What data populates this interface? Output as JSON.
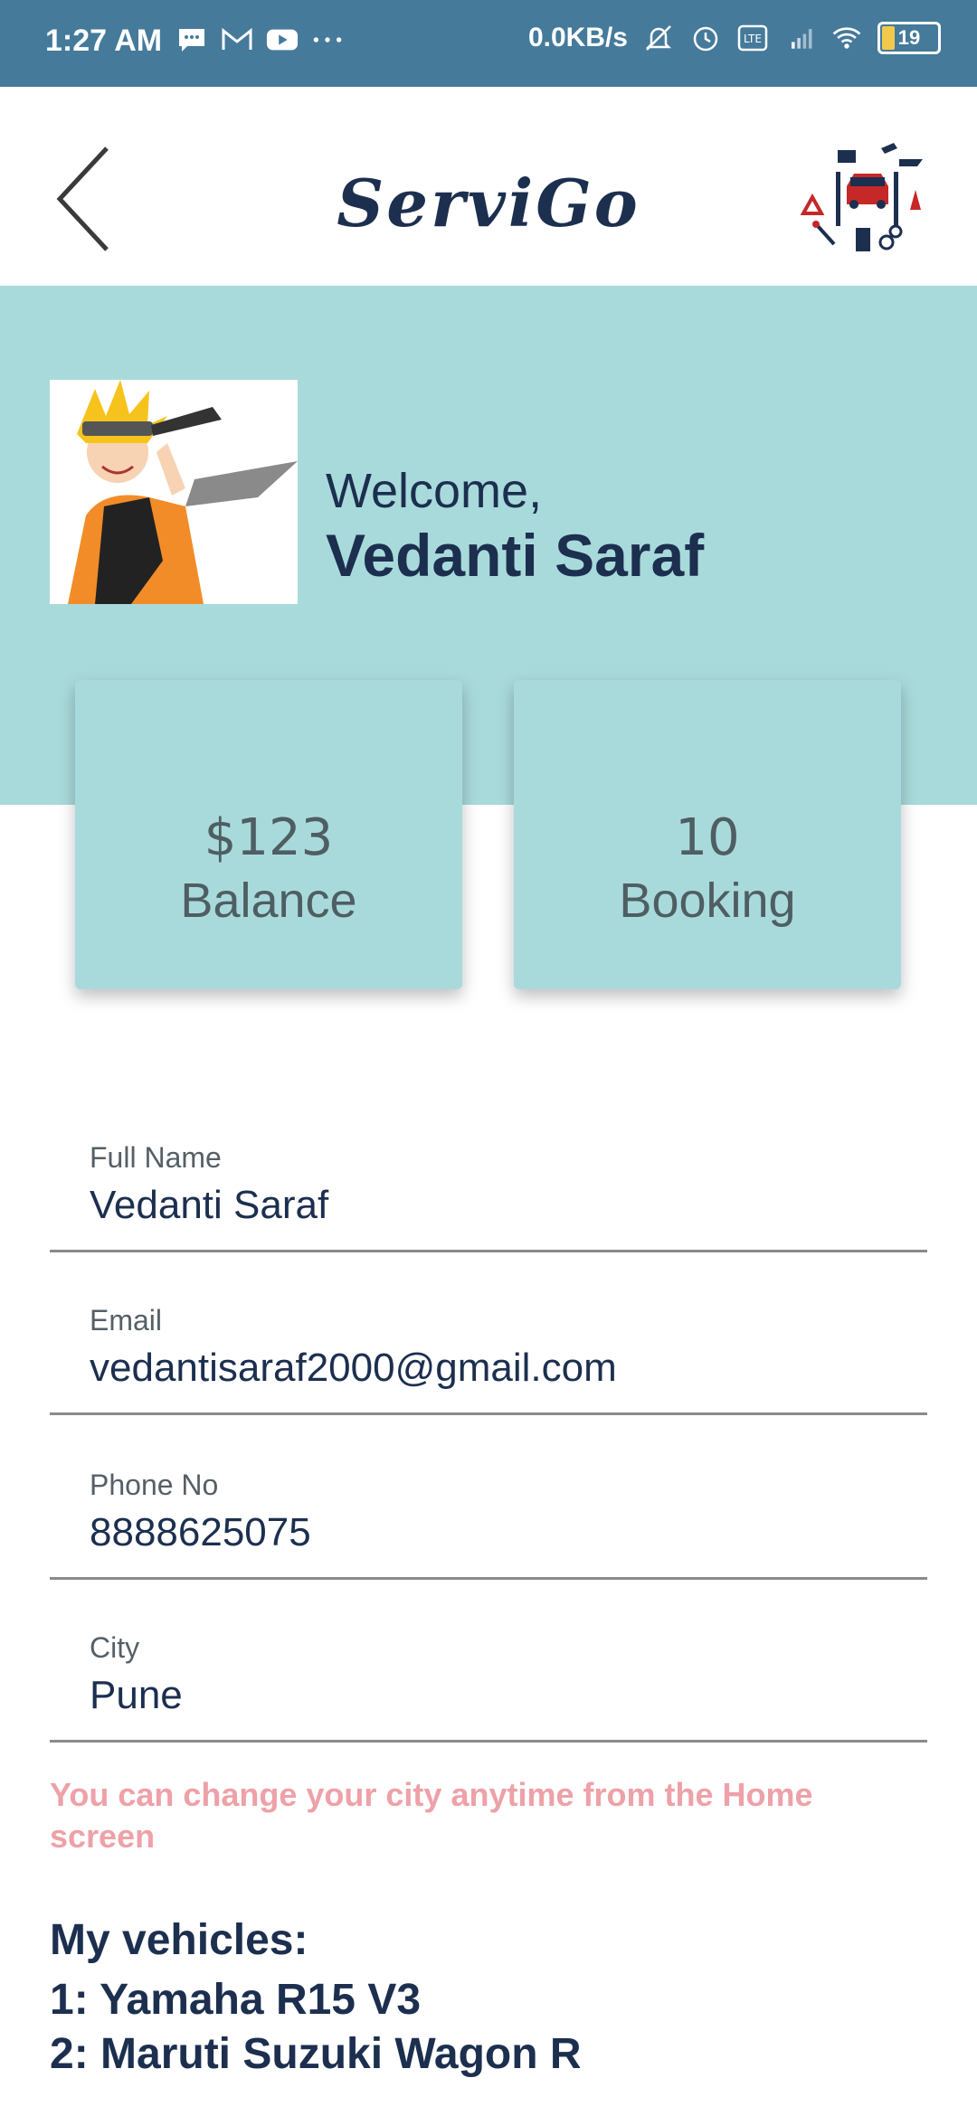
{
  "status_bar": {
    "time": "1:27 AM",
    "speed": "0.0KB/s",
    "battery": "19",
    "icons_left": [
      "message-icon",
      "gmail-icon",
      "youtube-icon",
      "more-dots-icon"
    ],
    "icons_right": [
      "mute-bell-icon",
      "alarm-icon",
      "volte-icon",
      "signal-icon",
      "wifi-icon",
      "battery-icon"
    ]
  },
  "app_bar": {
    "title": "ServiGo",
    "back_icon": "chevron-left-icon",
    "logo_icon": "car-service-logo-icon"
  },
  "profile": {
    "welcome": "Welcome,",
    "name": "Vedanti Saraf",
    "avatar": "anime-character-avatar"
  },
  "stats": {
    "balance_value": "$123",
    "balance_label": "Balance",
    "booking_value": "10",
    "booking_label": "Booking"
  },
  "form": {
    "full_name_label": "Full Name",
    "full_name_value": "Vedanti Saraf",
    "email_label": "Email",
    "email_value": "vedantisaraf2000@gmail.com",
    "phone_label": "Phone No",
    "phone_value": "8888625075",
    "city_label": "City",
    "city_value": "Pune"
  },
  "hint": "You can change your city anytime from the Home screen",
  "vehicles": {
    "title": "My vehicles:",
    "items": [
      "1: Yamaha R15 V3",
      "2: Maruti Suzuki Wagon R"
    ]
  },
  "colors": {
    "status_bar": "#457a9b",
    "header_band": "#a9dadb",
    "primary_text": "#1c2f4f",
    "hint_text": "#eea1a8"
  }
}
